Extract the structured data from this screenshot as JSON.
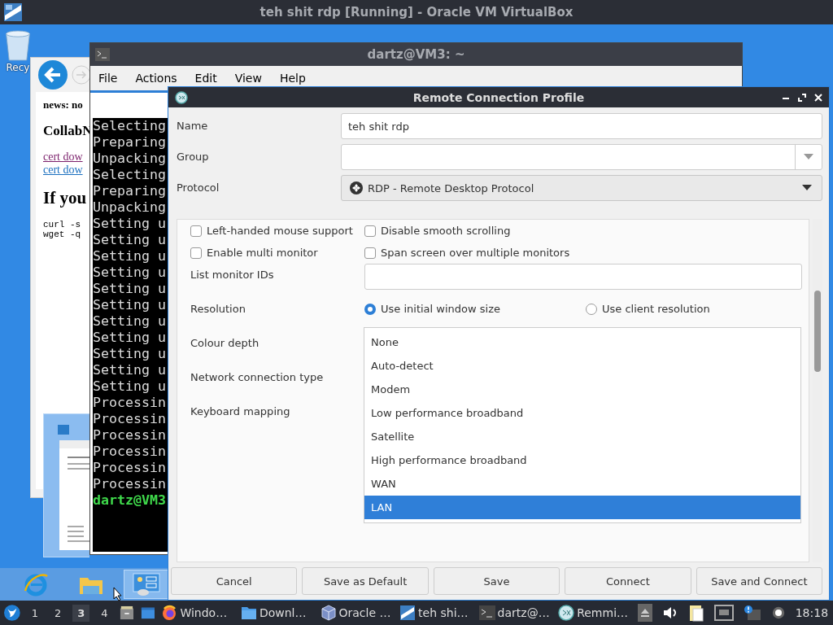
{
  "vbox": {
    "title": "teh shit rdp [Running] - Oracle VM VirtualBox"
  },
  "desktop": {
    "recycle_label": "Recy"
  },
  "browser": {
    "lines": [
      {
        "kind": "strong",
        "text": "news: no"
      },
      {
        "kind": "title",
        "text": "CollabN"
      },
      {
        "kind": "link",
        "text": "cert dow",
        "visited": true
      },
      {
        "kind": "link",
        "text": "cert dow",
        "visited": false
      },
      {
        "kind": "heading",
        "text": "If you"
      },
      {
        "kind": "code",
        "text": "curl -s"
      },
      {
        "kind": "code",
        "text": "wget -q"
      }
    ]
  },
  "terminal": {
    "title": "dartz@VM3: ~",
    "menu": [
      "File",
      "Actions",
      "Edit",
      "View",
      "Help"
    ],
    "lines": [
      {
        "kind": "output",
        "text": "Selecting"
      },
      {
        "kind": "output",
        "text": "Preparing"
      },
      {
        "kind": "output",
        "text": "Unpacking"
      },
      {
        "kind": "output",
        "text": "Selecting"
      },
      {
        "kind": "output",
        "text": "Preparing"
      },
      {
        "kind": "output",
        "text": "Unpacking"
      },
      {
        "kind": "output",
        "text": "Setting u"
      },
      {
        "kind": "output",
        "text": "Setting u"
      },
      {
        "kind": "output",
        "text": "Setting u"
      },
      {
        "kind": "output",
        "text": "Setting u"
      },
      {
        "kind": "output",
        "text": "Setting u"
      },
      {
        "kind": "output",
        "text": "Setting u"
      },
      {
        "kind": "output",
        "text": "Setting u"
      },
      {
        "kind": "output",
        "text": "Setting u"
      },
      {
        "kind": "output",
        "text": "Setting u"
      },
      {
        "kind": "output",
        "text": "Setting u"
      },
      {
        "kind": "output",
        "text": "Setting u"
      },
      {
        "kind": "output",
        "text": "Processin"
      },
      {
        "kind": "output",
        "text": "Processin"
      },
      {
        "kind": "output",
        "text": "Processin"
      },
      {
        "kind": "output",
        "text": "Processin"
      },
      {
        "kind": "output",
        "text": "Processin"
      },
      {
        "kind": "output",
        "text": "Processin"
      },
      {
        "kind": "prompt",
        "text": "dartz@VM3"
      }
    ]
  },
  "dialog": {
    "title": "Remote Connection Profile",
    "name": {
      "label": "Name",
      "value": "teh shit rdp"
    },
    "group": {
      "label": "Group"
    },
    "protocol": {
      "label": "Protocol",
      "value": "RDP - Remote Desktop Protocol"
    },
    "options": [
      {
        "label": "Left-handed mouse support",
        "checked": false
      },
      {
        "label": "Disable smooth scrolling",
        "checked": false
      },
      {
        "label": "Enable multi monitor",
        "checked": false
      },
      {
        "label": "Span screen over multiple monitors",
        "checked": false
      }
    ],
    "monitor_ids": {
      "label": "List monitor IDs"
    },
    "resolution": {
      "label": "Resolution",
      "options": [
        {
          "label": "Use initial window size",
          "selected": true
        },
        {
          "label": "Use client resolution",
          "selected": false
        }
      ]
    },
    "labels": [
      "Colour depth",
      "Network connection type",
      "Keyboard mapping"
    ],
    "dropdown": [
      {
        "label": "None",
        "selected": false
      },
      {
        "label": "Auto-detect",
        "selected": false
      },
      {
        "label": "Modem",
        "selected": false
      },
      {
        "label": "Low performance broadband",
        "selected": false
      },
      {
        "label": "Satellite",
        "selected": false
      },
      {
        "label": "High performance broadband",
        "selected": false
      },
      {
        "label": "WAN",
        "selected": false
      },
      {
        "label": "LAN",
        "selected": true
      }
    ],
    "buttons": [
      "Cancel",
      "Save as Default",
      "Save",
      "Connect",
      "Save and Connect"
    ]
  },
  "vm_taskbar": [
    {
      "kind": "browser",
      "selected": false
    },
    {
      "kind": "explorer",
      "selected": false
    },
    {
      "kind": "control",
      "selected": true
    }
  ],
  "host_taskbar": {
    "workspaces": [
      {
        "label": "1",
        "selected": false
      },
      {
        "label": "2",
        "selected": false
      },
      {
        "label": "3",
        "selected": true
      },
      {
        "label": "4",
        "selected": false
      }
    ],
    "tasks": [
      {
        "kind": "firefox",
        "label": "Windo…"
      },
      {
        "kind": "folder",
        "label": "Downl…"
      },
      {
        "kind": "vbox",
        "label": "Oracle …"
      },
      {
        "kind": "vm",
        "label": "teh shi…"
      },
      {
        "kind": "terminal",
        "label": "dartz@…"
      },
      {
        "kind": "remmina",
        "label": "Remmi…"
      }
    ],
    "clock": "18:18"
  }
}
